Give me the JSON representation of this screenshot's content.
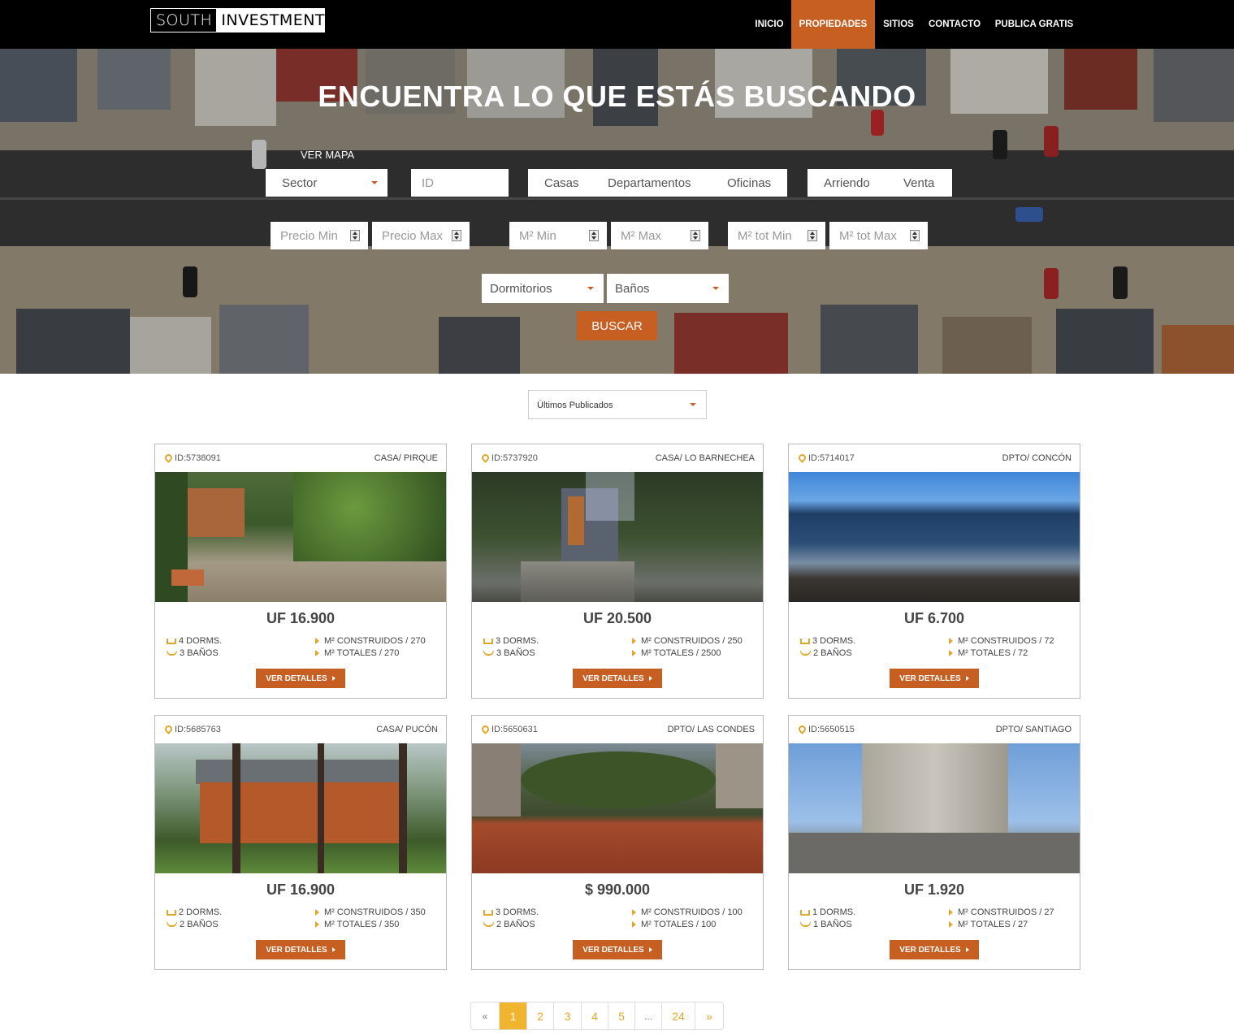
{
  "nav": {
    "logo_left": "SOUTH",
    "logo_right": "INVESTMENT",
    "items": [
      {
        "label": "INICIO",
        "active": false
      },
      {
        "label": "PROPIEDADES",
        "active": true
      },
      {
        "label": "SITIOS",
        "active": false
      },
      {
        "label": "CONTACTO",
        "active": false
      },
      {
        "label": "PUBLICA GRATIS",
        "active": false
      }
    ]
  },
  "hero": {
    "title": "ENCUENTRA LO QUE ESTÁS BUSCANDO",
    "ver_mapa": "VER MAPA",
    "sector": "Sector",
    "id_placeholder": "ID",
    "types": [
      "Casas",
      "Departamentos",
      "Oficinas"
    ],
    "operations": [
      "Arriendo",
      "Venta"
    ],
    "precio_min": "Precio Min",
    "precio_max": "Precio Max",
    "m2_min": "M² Min",
    "m2_max": "M² Max",
    "m2_tot_min": "M² tot Min",
    "m2_tot_max": "M² tot Max",
    "dormitorios": "Dormitorios",
    "banos": "Baños",
    "buscar": "BUSCAR"
  },
  "sort": {
    "selected": "Últimos Publicados"
  },
  "listings": [
    {
      "id": "ID:5738091",
      "type": "CASA/ PIRQUE",
      "price": "UF 16.900",
      "dorms": "4 DORMS.",
      "banos": "3 BAÑOS",
      "construidos": "M² CONSTRUIDOS / 270",
      "totales": "M² TOTALES / 270",
      "button": "VER DETALLES"
    },
    {
      "id": "ID:5737920",
      "type": "CASA/ LO BARNECHEA",
      "price": "UF 20.500",
      "dorms": "3 DORMS.",
      "banos": "3 BAÑOS",
      "construidos": "M² CONSTRUIDOS / 250",
      "totales": "M² TOTALES / 2500",
      "button": "VER DETALLES"
    },
    {
      "id": "ID:5714017",
      "type": "DPTO/ CONCÓN",
      "price": "UF 6.700",
      "dorms": "3 DORMS.",
      "banos": "2 BAÑOS",
      "construidos": "M² CONSTRUIDOS / 72",
      "totales": "M² TOTALES / 72",
      "button": "VER DETALLES"
    },
    {
      "id": "ID:5685763",
      "type": "CASA/ PUCÓN",
      "price": "UF 16.900",
      "dorms": "2 DORMS.",
      "banos": "2 BAÑOS",
      "construidos": "M² CONSTRUIDOS / 350",
      "totales": "M² TOTALES / 350",
      "button": "VER DETALLES"
    },
    {
      "id": "ID:5650631",
      "type": "DPTO/ LAS CONDES",
      "price": "$ 990.000",
      "dorms": "3 DORMS.",
      "banos": "2 BAÑOS",
      "construidos": "M² CONSTRUIDOS / 100",
      "totales": "M² TOTALES / 100",
      "button": "VER DETALLES"
    },
    {
      "id": "ID:5650515",
      "type": "DPTO/ SANTIAGO",
      "price": "UF 1.920",
      "dorms": "1 DORMS.",
      "banos": "1 BAÑOS",
      "construidos": "M² CONSTRUIDOS / 27",
      "totales": "M² TOTALES / 27",
      "button": "VER DETALLES"
    }
  ],
  "pagination": [
    "«",
    "1",
    "2",
    "3",
    "4",
    "5",
    "...",
    "24",
    "»"
  ],
  "colors": {
    "accent": "#c85f22",
    "gold": "#e0a72a",
    "active_page": "#f1b42f"
  },
  "icons": {
    "pin": "map-pin-icon",
    "bed": "bed-icon",
    "bath": "bathtub-icon",
    "arrow": "triangle-right-icon"
  }
}
